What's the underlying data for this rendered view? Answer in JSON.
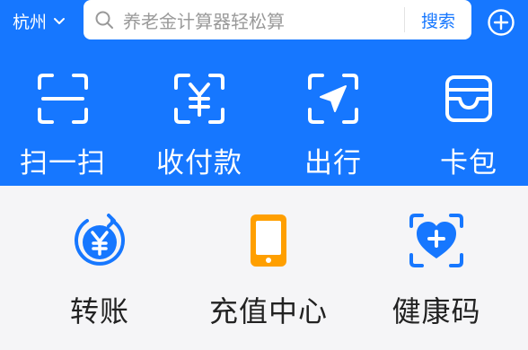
{
  "header": {
    "city": "杭州",
    "search_placeholder": "养老金计算器轻松算",
    "search_button": "搜索"
  },
  "quick_actions": [
    {
      "label": "扫一扫",
      "icon": "scan-icon"
    },
    {
      "label": "收付款",
      "icon": "payment-code-icon"
    },
    {
      "label": "出行",
      "icon": "navigation-arrow-icon"
    },
    {
      "label": "卡包",
      "icon": "card-wallet-icon"
    }
  ],
  "services": [
    {
      "label": "转账",
      "icon": "transfer-yuan-icon",
      "color": "#1677ff"
    },
    {
      "label": "充值中心",
      "icon": "phone-recharge-icon",
      "color": "#ff9f00"
    },
    {
      "label": "健康码",
      "icon": "health-code-icon",
      "color": "#1677ff"
    }
  ],
  "colors": {
    "brand": "#1677ff",
    "orange": "#ff9f00",
    "background": "#f5f5f7"
  }
}
